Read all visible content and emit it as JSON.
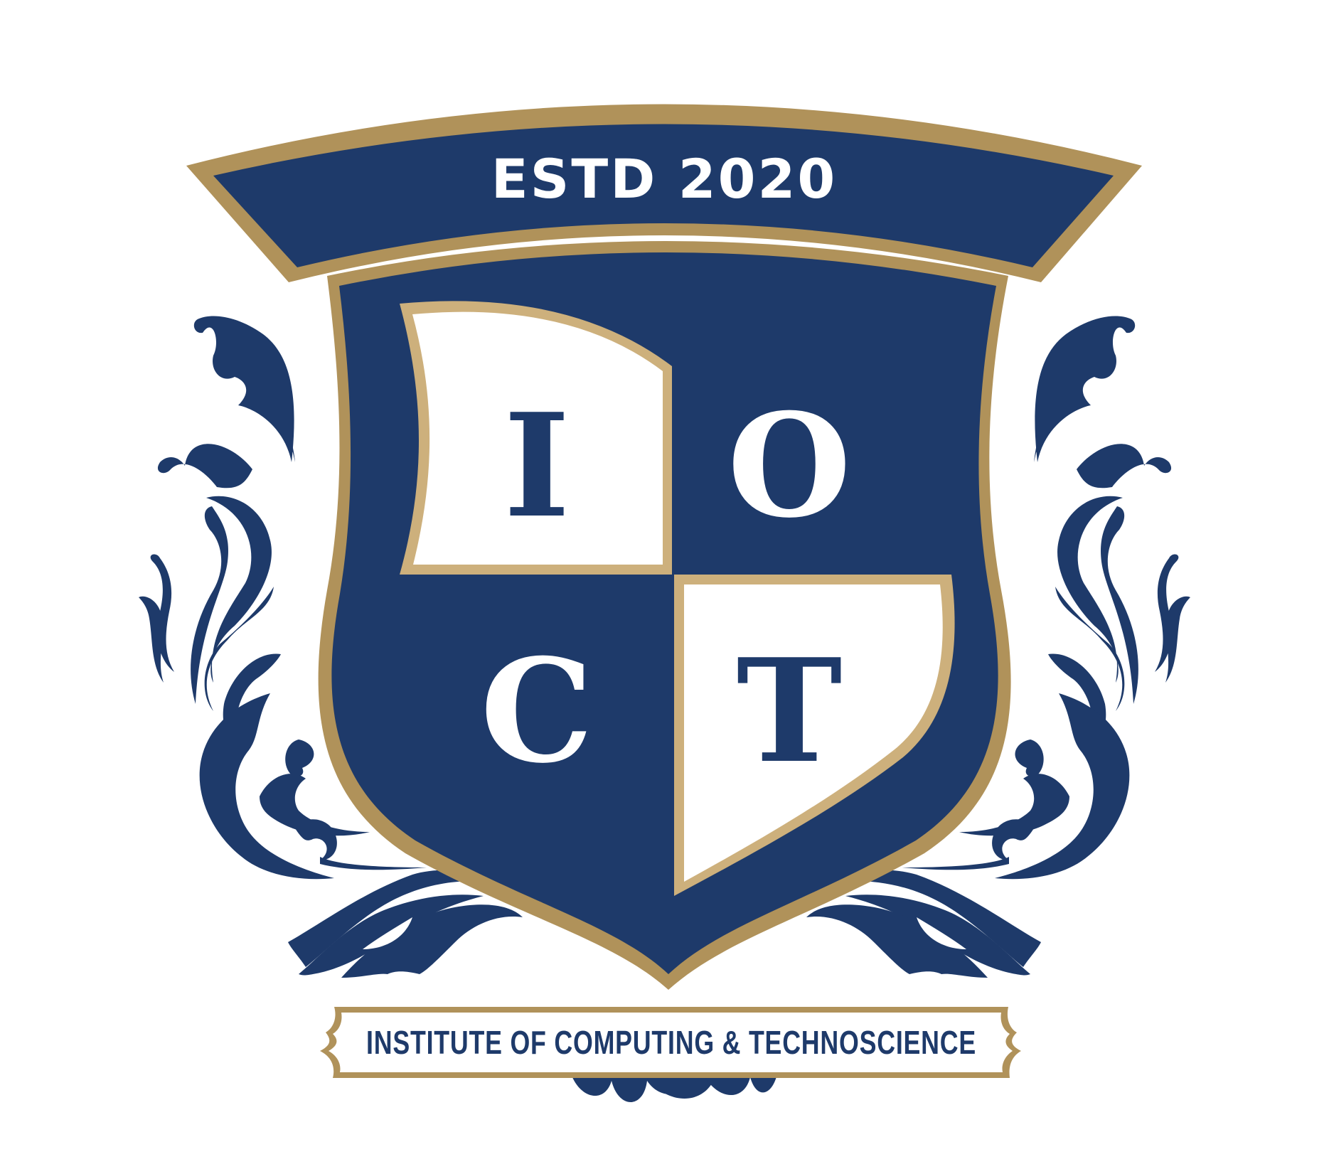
{
  "logo": {
    "established": "ESTD 2020",
    "letters": {
      "top_left": "I",
      "top_right": "O",
      "bottom_left": "C",
      "bottom_right": "T"
    },
    "institution_name": "INSTITUTE OF COMPUTING & TECHNOSCIENCE"
  },
  "colors": {
    "navy": "#1e3a6a",
    "gold": "#b0925a",
    "light_gold": "#cdb07c",
    "white": "#ffffff"
  }
}
